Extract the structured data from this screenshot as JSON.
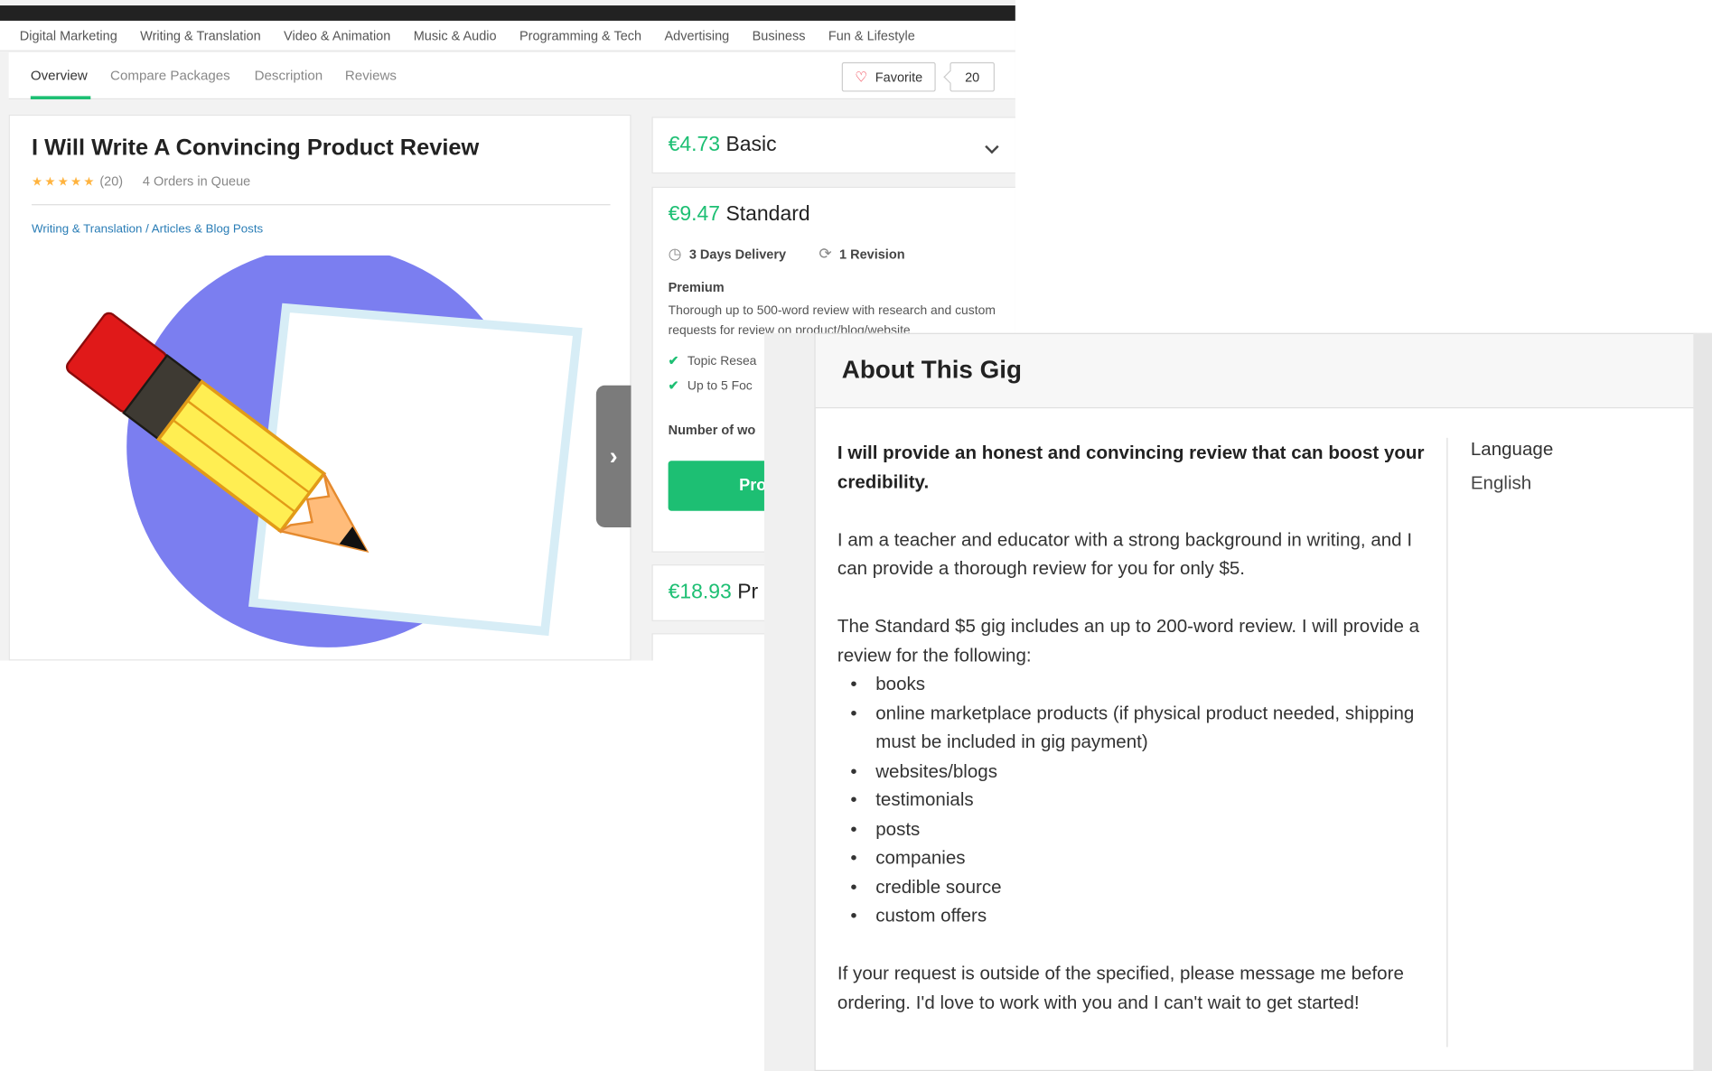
{
  "category_nav": [
    "Digital Marketing",
    "Writing & Translation",
    "Video & Animation",
    "Music & Audio",
    "Programming & Tech",
    "Advertising",
    "Business",
    "Fun & Lifestyle"
  ],
  "sub_nav": {
    "tabs": [
      "Overview",
      "Compare Packages",
      "Description",
      "Reviews"
    ],
    "active_tab": "Overview",
    "favorite_label": "Favorite",
    "favorite_count": "20"
  },
  "gig": {
    "title": "I Will Write A Convincing Product Review",
    "rating_stars": 5,
    "review_count": "(20)",
    "orders_in_queue": "4 Orders in Queue",
    "breadcrumb": "Writing & Translation / Articles & Blog Posts"
  },
  "packages": {
    "basic": {
      "price": "€4.73",
      "name": "Basic"
    },
    "standard": {
      "price": "€9.47",
      "name": "Standard",
      "delivery": "3 Days Delivery",
      "revisions": "1 Revision",
      "subtitle": "Premium",
      "description": "Thorough up to 500-word review with research and custom requests for review on product/blog/website",
      "features": [
        "Topic Resea",
        "Up to 5 Foc"
      ],
      "number_of_words_label": "Number of wo",
      "proceed_label": "Pro"
    },
    "premium": {
      "price": "€18.93",
      "name": "Pr"
    }
  },
  "about": {
    "title": "About This Gig",
    "lead": "I will provide an honest and convincing review that can boost your credibility.",
    "paragraph1": "I am a teacher and educator with a strong background in writing, and I can provide a thorough review for you for only $5.",
    "paragraph2": "The Standard $5 gig includes an up to 200-word review. I will provide a review for the following:",
    "list": [
      "books",
      "online marketplace products (if physical product needed, shipping must be included in gig payment)",
      "websites/blogs",
      "testimonials",
      "posts",
      "companies",
      "credible source",
      "custom offers"
    ],
    "paragraph3": "If your request is outside of the specified, please message me before ordering. I'd love to work with you and I can't wait to get started!",
    "language_label": "Language",
    "language_value": "English"
  },
  "colors": {
    "accent_green": "#1dbf73",
    "link_blue": "#2a7db6",
    "star": "#ffb33e",
    "heart": "#e22233"
  }
}
